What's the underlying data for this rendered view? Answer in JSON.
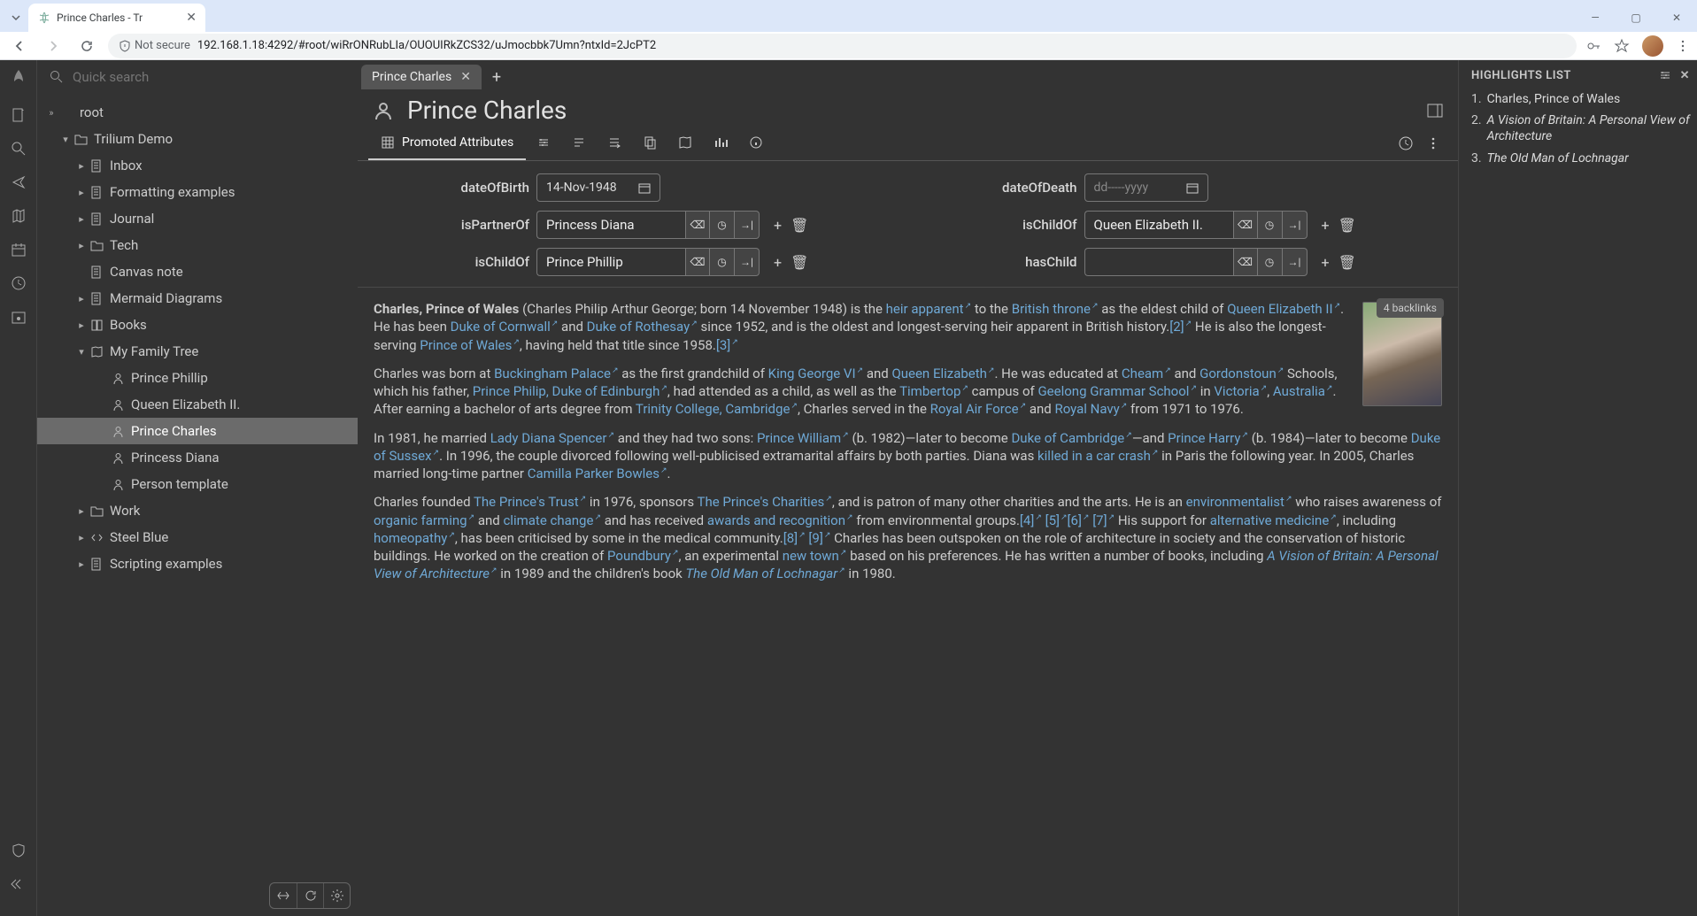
{
  "browser": {
    "tab_title": "Prince Charles - Tr",
    "not_secure": "Not secure",
    "url": "192.168.1.18:4292/#root/wiRrONRubLIa/OUOUIRkZCS32/uJmocbbk7Umn?ntxId=2JcPT2"
  },
  "sidebar": {
    "search_placeholder": "Quick search",
    "items": [
      {
        "label": "root",
        "icon": "collapse",
        "indent": 0,
        "exp": "»"
      },
      {
        "label": "Trilium Demo",
        "icon": "folder",
        "indent": 1,
        "exp": "▾"
      },
      {
        "label": "Inbox",
        "icon": "note",
        "indent": 2,
        "exp": "▸"
      },
      {
        "label": "Formatting examples",
        "icon": "note",
        "indent": 2,
        "exp": "▸"
      },
      {
        "label": "Journal",
        "icon": "note",
        "indent": 2,
        "exp": "▸"
      },
      {
        "label": "Tech",
        "icon": "folder",
        "indent": 2,
        "exp": "▸"
      },
      {
        "label": "Canvas note",
        "icon": "note",
        "indent": 2,
        "exp": ""
      },
      {
        "label": "Mermaid Diagrams",
        "icon": "note",
        "indent": 2,
        "exp": "▸"
      },
      {
        "label": "Books",
        "icon": "book",
        "indent": 2,
        "exp": "▸"
      },
      {
        "label": "My Family Tree",
        "icon": "map",
        "indent": 2,
        "exp": "▾"
      },
      {
        "label": "Prince Phillip",
        "icon": "person",
        "indent": 3,
        "exp": ""
      },
      {
        "label": "Queen Elizabeth II.",
        "icon": "person",
        "indent": 3,
        "exp": ""
      },
      {
        "label": "Prince Charles",
        "icon": "person",
        "indent": 3,
        "exp": "",
        "active": true
      },
      {
        "label": "Princess Diana",
        "icon": "person",
        "indent": 3,
        "exp": ""
      },
      {
        "label": "Person template",
        "icon": "person",
        "indent": 3,
        "exp": ""
      },
      {
        "label": "Work",
        "icon": "folder",
        "indent": 2,
        "exp": "▸"
      },
      {
        "label": "Steel Blue",
        "icon": "code",
        "indent": 2,
        "exp": "▸"
      },
      {
        "label": "Scripting examples",
        "icon": "note",
        "indent": 2,
        "exp": "▸"
      }
    ]
  },
  "tabs": {
    "active": "Prince Charles"
  },
  "note": {
    "title": "Prince Charles",
    "ribbon": {
      "promoted": "Promoted Attributes"
    },
    "attrs": {
      "dateOfBirth": {
        "label": "dateOfBirth",
        "value": "14-Nov-1948"
      },
      "dateOfDeath": {
        "label": "dateOfDeath",
        "placeholder": "dd-----yyyy"
      },
      "isPartnerOf": {
        "label": "isPartnerOf",
        "value": "Princess Diana"
      },
      "isChildOf1": {
        "label": "isChildOf",
        "value": "Queen Elizabeth II."
      },
      "isChildOf2": {
        "label": "isChildOf",
        "value": "Prince Phillip"
      },
      "hasChild": {
        "label": "hasChild",
        "value": ""
      }
    },
    "backlinks": "4 backlinks"
  },
  "highlights": {
    "header": "HIGHLIGHTS LIST",
    "items": [
      {
        "label": "Charles, Prince of Wales",
        "italic": false
      },
      {
        "label": "A Vision of Britain: A Personal View of Architecture",
        "italic": true
      },
      {
        "label": "The Old Man of Lochnagar",
        "italic": true
      }
    ]
  },
  "body": {
    "p1_a": "Charles, Prince of Wales",
    "p1_b": " (Charles Philip Arthur George; born 14 November 1948) is the ",
    "p1_heir": "heir apparent",
    "p1_c": " to the ",
    "p1_throne": "British throne",
    "p1_d": " as the eldest child of ",
    "p1_qe": "Queen Elizabeth II",
    "p1_e": ". He has been ",
    "p1_cornwall": "Duke of Cornwall",
    "p1_f": " and ",
    "p1_rothesay": "Duke of Rothesay",
    "p1_g": " since 1952, and is the oldest and longest-serving heir apparent in British history.",
    "p1_ref2": "[2]",
    "p1_h": " He is also the longest-serving ",
    "p1_pow": "Prince of Wales",
    "p1_i": ", having held that title since 1958.",
    "p1_ref3": "[3]",
    "p2_a": "Charles was born at ",
    "p2_buck": "Buckingham Palace",
    "p2_b": " as the first grandchild of ",
    "p2_kg": "King George VI",
    "p2_c": " and ",
    "p2_qe": "Queen Elizabeth",
    "p2_d": ". He was educated at ",
    "p2_cheam": "Cheam",
    "p2_e": " and ",
    "p2_gord": "Gordonstoun",
    "p2_f": " Schools, which his father, ",
    "p2_philip": "Prince Philip, Duke of Edinburgh",
    "p2_g": ", had attended as a child, as well as the ",
    "p2_timb": "Timbertop",
    "p2_h": " campus of ",
    "p2_geel": "Geelong Grammar School",
    "p2_i": " in ",
    "p2_vic": "Victoria",
    "p2_j": ", ",
    "p2_aus": "Australia",
    "p2_k": ". After earning a bachelor of arts degree from ",
    "p2_trin": "Trinity College, Cambridge",
    "p2_l": ", Charles served in the ",
    "p2_raf": "Royal Air Force",
    "p2_m": " and ",
    "p2_navy": "Royal Navy",
    "p2_n": " from 1971 to 1976.",
    "p3_a": "In 1981, he married ",
    "p3_diana": "Lady Diana Spencer",
    "p3_b": " and they had two sons: ",
    "p3_will": "Prince William",
    "p3_c": " (b. 1982)—later to become ",
    "p3_dcamb": "Duke of Cambridge",
    "p3_d": "—and ",
    "p3_harry": "Prince Harry",
    "p3_e": " (b. 1984)—later to become ",
    "p3_sussex": "Duke of Sussex",
    "p3_f": ". In 1996, the couple divorced following well-publicised extramarital affairs by both parties. Diana was ",
    "p3_crash": "killed in a car crash",
    "p3_g": " in Paris the following year. In 2005, Charles married long-time partner ",
    "p3_cam": "Camilla Parker Bowles",
    "p3_h": ".",
    "p4_a": "Charles founded ",
    "p4_trust": "The Prince's Trust",
    "p4_b": " in 1976, sponsors ",
    "p4_char": "The Prince's Charities",
    "p4_c": ", and is patron of many other charities and the arts. He is an ",
    "p4_env": "environmentalist",
    "p4_d": " who raises awareness of ",
    "p4_org": "organic farming",
    "p4_e": " and ",
    "p4_clim": "climate change",
    "p4_f": " and has received ",
    "p4_awards": "awards and recognition",
    "p4_g": " from environmental groups.",
    "p4_r4": "[4]",
    "p4_r5": "[5]",
    "p4_r6": "[6]",
    "p4_r7": "[7]",
    "p4_h": " His support for ",
    "p4_alt": "alternative medicine",
    "p4_i": ", including ",
    "p4_hom": "homeopathy",
    "p4_j": ", has been criticised by some in the medical community.",
    "p4_r8": "[8]",
    "p4_r9": "[9]",
    "p4_k": " Charles has been outspoken on the role of architecture in society and the conservation of historic buildings. He worked on the creation of ",
    "p4_pound": "Poundbury",
    "p4_l": ", an experimental ",
    "p4_newtown": "new town",
    "p4_m": " based on his preferences. He has written a number of books, including ",
    "p4_vision": "A Vision of Britain: A Personal View of Architecture",
    "p4_n": " in 1989 and the children's book ",
    "p4_loch": "The Old Man of Lochnagar",
    "p4_o": " in 1980."
  }
}
